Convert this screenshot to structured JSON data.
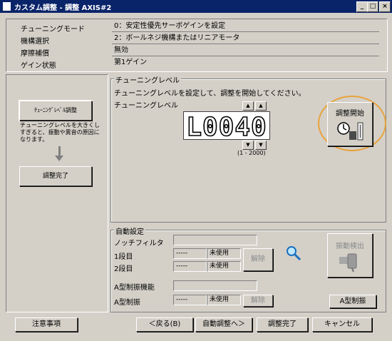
{
  "window": {
    "title": "カスタム調整 - 調整 AXIS#2",
    "minimize": "_",
    "maximize": "□",
    "close": "×"
  },
  "info": [
    {
      "label": "チューニングモード",
      "value": "0：安定性優先サーボゲインを設定"
    },
    {
      "label": "機構選択",
      "value": "2：ボールネジ機構またはリニアモータ"
    },
    {
      "label": "摩擦補償",
      "value": "無効"
    },
    {
      "label": "ゲイン状態",
      "value": "第1ゲイン"
    }
  ],
  "flow": {
    "step1": "ﾁｭｰﾆﾝｸﾞﾚﾍﾞﾙ調整",
    "note": "チューニングレベルを大きくしすぎると、振動や異音の原因になります。",
    "step2": "調整完了"
  },
  "tuning": {
    "group_label": "チューニングレベル",
    "instruction": "チューニングレベルを設定して、調整を開始してください。",
    "level_label": "チューニングレベル",
    "display": "L0040",
    "range": "(1 - 2000)",
    "start_button": "調整開始"
  },
  "auto": {
    "group_label": "自動設定",
    "notch_label": "ノッチフィルタ",
    "stage1_label": "1段目",
    "stage1_value": "-----",
    "stage1_status": "未使用",
    "stage2_label": "2段目",
    "stage2_value": "-----",
    "stage2_status": "未使用",
    "release1": "解除",
    "vib_label": "A型制振機能",
    "atype_label": "A型制振",
    "atype_value": "-----",
    "atype_status": "未使用",
    "release2": "解除",
    "detect_button": "振動検出",
    "atype_button": "A型制振"
  },
  "footer": {
    "notes": "注意事項",
    "back": "＜戻る(B)",
    "auto_tune": "自動調整へ＞",
    "complete": "調整完了",
    "cancel": "キャンセル"
  },
  "accent": "#e8a33d"
}
